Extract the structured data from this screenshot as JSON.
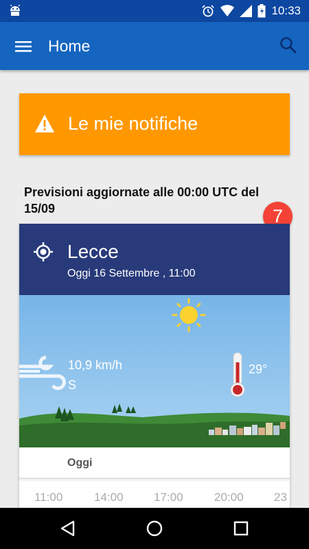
{
  "status_bar": {
    "time": "10:33",
    "icons": [
      "android-icon",
      "alarm-icon",
      "wifi-icon",
      "signal-icon",
      "battery-icon"
    ]
  },
  "app_bar": {
    "title": "Home",
    "menu_icon": "menu-icon",
    "search_icon": "search-icon",
    "color": "#1565c0"
  },
  "notifications": {
    "label": "Le mie notifiche",
    "count": "7",
    "icon": "warning-icon",
    "color": "#ff9800",
    "badge_color": "#f44336"
  },
  "forecast_info": "Previsioni aggiornate alle 00:00 UTC del 15/09",
  "weather_card": {
    "city": "Lecce",
    "date": "Oggi 16 Settembre , 11:00",
    "wind_speed": "10,9 km/h",
    "wind_direction": "S",
    "temperature": "29°",
    "header_color": "#283a7a",
    "sky_color": "#7fbcea"
  },
  "day_tab": "Oggi",
  "hours": [
    "11:00",
    "14:00",
    "17:00",
    "20:00",
    "23"
  ],
  "nav": [
    "back-icon",
    "home-icon",
    "recents-icon"
  ]
}
